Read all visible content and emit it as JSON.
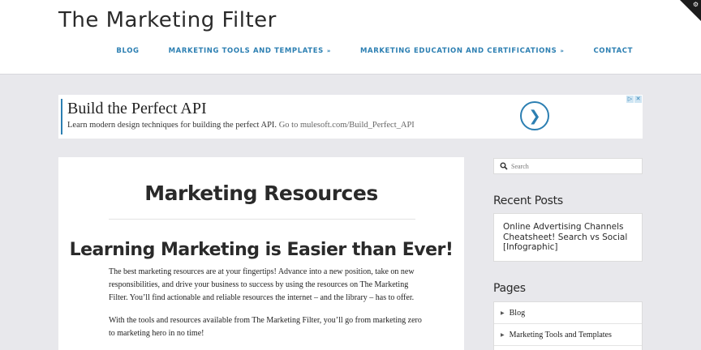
{
  "site": {
    "title": "The Marketing Filter"
  },
  "nav": {
    "items": [
      {
        "label": "BLOG",
        "caret": ""
      },
      {
        "label": "MARKETING TOOLS AND TEMPLATES",
        "caret": "»"
      },
      {
        "label": "MARKETING EDUCATION AND CERTIFICATIONS",
        "caret": "»"
      },
      {
        "label": "CONTACT",
        "caret": ""
      }
    ]
  },
  "ad": {
    "title": "Build the Perfect API",
    "text": "Learn modern design techniques for building the perfect API.",
    "link": "Go to mulesoft.com/Build_Perfect_API",
    "button_glyph": "❯",
    "choices_glyphs": [
      "▷",
      "✕"
    ]
  },
  "main": {
    "title": "Marketing Resources",
    "heading": "Learning Marketing is Easier than Ever!",
    "paragraph1": "The best marketing resources are at your fingertips! Advance into a new position, take on new responsibilities, and drive your business to success by using the resources on The Marketing Filter. You’ll find actionable and reliable resources the internet – and the library – has to offer.",
    "paragraph2": "With the tools and resources available from The Marketing Filter, you’ll go from marketing zero to marketing hero in no time!"
  },
  "sidebar": {
    "search_placeholder": "Search",
    "recent_heading": "Recent Posts",
    "recent_posts": [
      "Online Advertising Channels Cheatsheet! Search vs Social [Infographic]"
    ],
    "pages_heading": "Pages",
    "pages": [
      "Blog",
      "Marketing Tools and Templates"
    ]
  },
  "colors": {
    "accent": "#2c7fb2",
    "background": "#e8e8ec",
    "text": "#2a2a2a"
  },
  "icons": {
    "search": "search-icon",
    "gear": "gear-icon",
    "arrow": "chevron-right-icon"
  }
}
